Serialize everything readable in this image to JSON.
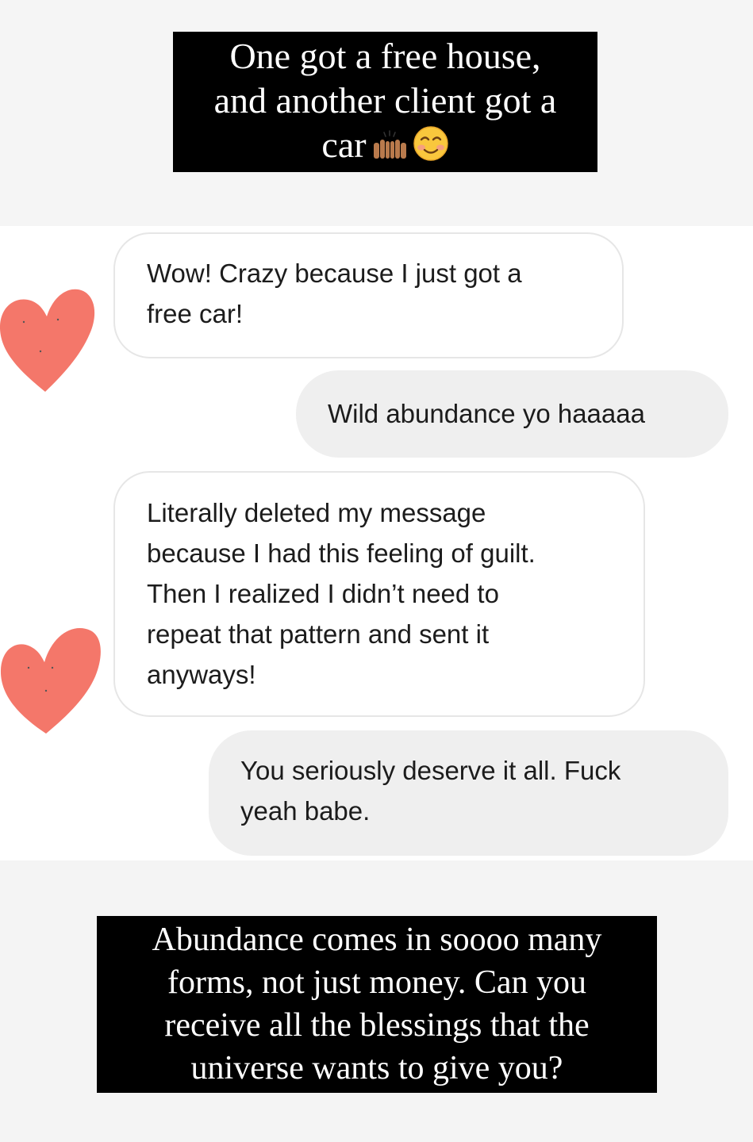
{
  "story": {
    "caption_top": {
      "line1": "One got a free house,",
      "line2": "and another client got a",
      "line3": "car",
      "emoji_icons": [
        "raising-hands-icon",
        "smiling-face-icon"
      ]
    },
    "messages": [
      {
        "sender": "them",
        "line1": "Wow! Crazy because I just got a",
        "line2": "free car!",
        "reaction": "heart-icon"
      },
      {
        "sender": "me",
        "line1": "Wild abundance yo haaaaa"
      },
      {
        "sender": "them",
        "line1": "Literally deleted my message",
        "line2": "because I had this feeling of guilt.",
        "line3": "Then I realized I didn’t need to",
        "line4": "repeat that pattern and sent it",
        "line5": "anyways!",
        "reaction": "heart-icon"
      },
      {
        "sender": "me",
        "line1": "You seriously deserve it all. Fuck",
        "line2": "yeah babe."
      }
    ],
    "caption_bottom": {
      "line1": "Abundance comes in soooo many",
      "line2": "forms, not just money. Can you",
      "line3": "receive all the blessings that the",
      "line4": "universe wants to give you?"
    },
    "colors": {
      "caption_bg": "#000000",
      "caption_text": "#ffffff",
      "incoming_bubble": "#ffffff",
      "outgoing_bubble": "#efefef",
      "heart": "#f4776a"
    }
  }
}
